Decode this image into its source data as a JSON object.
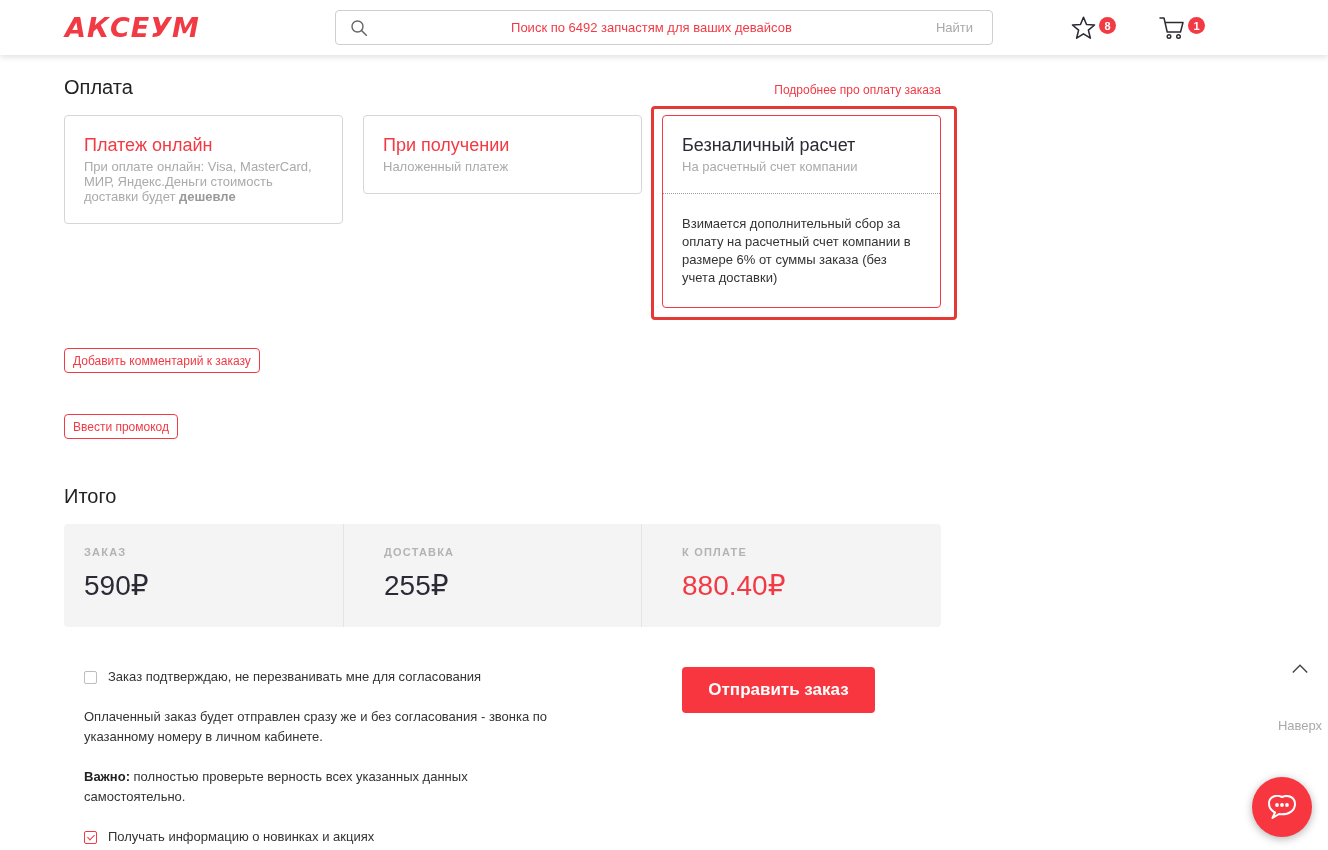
{
  "header": {
    "logo": "АКСЕУМ",
    "search": {
      "placeholder": "Поиск по 6492 запчастям для ваших девайсов",
      "button": "Найти"
    },
    "favorites": {
      "count": "8"
    },
    "cart": {
      "count": "1"
    }
  },
  "payment": {
    "title": "Оплата",
    "details_link": "Подробнее про оплату заказа",
    "options": [
      {
        "title": "Платеж онлайн",
        "subtitle": "При оплате онлайн: Visa, MasterCard, МИР, Яндекс.Деньги стоимость доставки будет **дешевле**",
        "selected": false
      },
      {
        "title": "При получении",
        "subtitle": "Наложенный платеж",
        "selected": false
      },
      {
        "title": "Безналичный расчет",
        "subtitle": "На расчетный счет компании",
        "note": "Взимается дополнительный сбор за оплату на расчетный счет компании в размере 6% от суммы заказа (без учета доставки)",
        "selected": true
      }
    ]
  },
  "actions": [
    "Добавить комментарий к заказу",
    "Ввести промокод"
  ],
  "totals": {
    "title": "Итого",
    "items": [
      {
        "label": "ЗАКАЗ",
        "value": "590₽",
        "kind": "plain"
      },
      {
        "label": "ДОСТАВКА",
        "value": "255₽",
        "kind": "plain"
      },
      {
        "label": "К ОПЛАТЕ",
        "value": "880.40₽",
        "kind": "due"
      }
    ]
  },
  "confirmation": {
    "no_callback": {
      "label": "Заказ подтверждаю, не перезванивать мне для согласования",
      "checked": false
    },
    "info": "Оплаченный заказ будет отправлен сразу же и без согласования - звонка по указанному номеру в личном кабинете.",
    "warning": "**Важно:** полностью проверьте верность всех указанных данных самостоятельно.",
    "newsletter": {
      "label": "Получать информацию о новинках и акциях",
      "checked": true
    }
  },
  "submit": "Отправить заказ",
  "scroll_top": {
    "label": "Наверх"
  }
}
